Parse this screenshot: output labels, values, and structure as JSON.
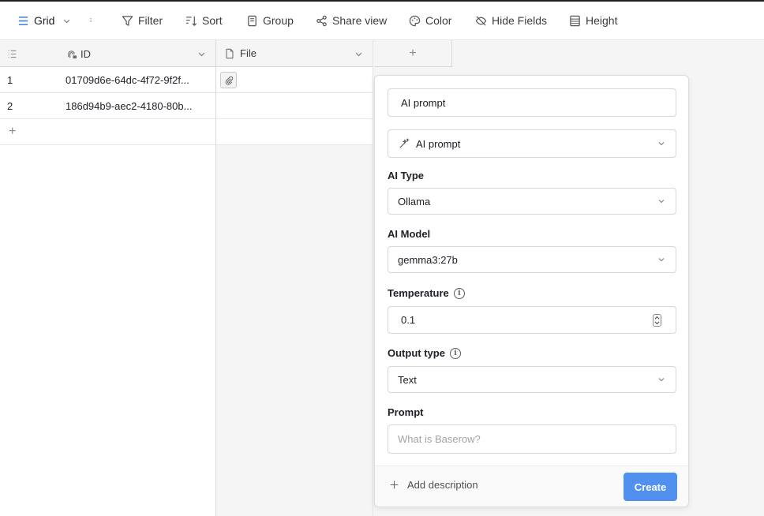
{
  "toolbar": {
    "view_name": "Grid",
    "filter": "Filter",
    "sort": "Sort",
    "group": "Group",
    "share_view": "Share view",
    "color": "Color",
    "hide_fields": "Hide Fields",
    "height": "Height"
  },
  "grid": {
    "columns": [
      {
        "name": "ID"
      },
      {
        "name": "File"
      }
    ],
    "add_column": "+",
    "rows": [
      {
        "num": "1",
        "id": "01709d6e-64dc-4f72-9f2f..."
      },
      {
        "num": "2",
        "id": "186d94b9-aec2-4180-80b..."
      }
    ],
    "add_row": "+"
  },
  "modal": {
    "field_name_value": "AI prompt",
    "field_type": "AI prompt",
    "ai_type_label": "AI Type",
    "ai_type_value": "Ollama",
    "ai_model_label": "AI Model",
    "ai_model_value": "gemma3:27b",
    "temperature_label": "Temperature",
    "temperature_value": "0.1",
    "output_type_label": "Output type",
    "output_type_value": "Text",
    "prompt_label": "Prompt",
    "prompt_placeholder": "What is Baserow?",
    "add_description": "Add description",
    "create": "Create"
  },
  "colors": {
    "accent": "#5190ef",
    "grid_bg": "#f5f5f5"
  }
}
